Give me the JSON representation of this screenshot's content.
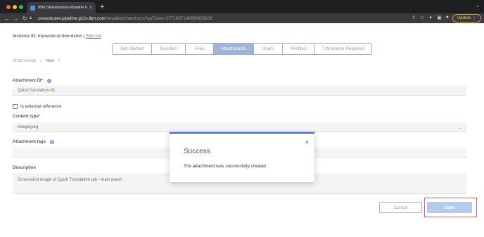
{
  "browser": {
    "tab_title": "IBM Globalization Pipeline New",
    "tab_close": "×",
    "new_tab": "+",
    "tab_menu": "⌄",
    "nav": {
      "back": "←",
      "forward": "→",
      "reload": "↻"
    },
    "url_host": "console.dev.pipeline.g11n.ibm.com",
    "url_path": "/newattachment.wss?gpToken=3771687149959903608",
    "update_label": "Update",
    "update_menu": "⋮",
    "icons": [
      "share-icon",
      "star-icon",
      "extension-icon",
      "sidebar-icon",
      "profile-icon"
    ]
  },
  "header": {
    "instance_label": "Instance ID: translate-at-ibm-demo |",
    "sign_out": "Sign out"
  },
  "tabs": [
    {
      "label": "Get Started",
      "active": false
    },
    {
      "label": "Bundles",
      "active": false
    },
    {
      "label": "Files",
      "active": false
    },
    {
      "label": "Attachments",
      "active": true
    },
    {
      "label": "Users",
      "active": false
    },
    {
      "label": "Profiles",
      "active": false
    },
    {
      "label": "Translation Requests",
      "active": false
    }
  ],
  "breadcrumb": {
    "root": "Attachments",
    "sep": "/",
    "current": "New",
    "trail": "/"
  },
  "form": {
    "attachment_id_label": "Attachment ID*",
    "attachment_id_value": "QuickTranslation-01",
    "external_ref_label": "Is external reference",
    "content_type_label": "Content type*",
    "content_type_value": "image/jpeg",
    "tags_label": "Attachment tags",
    "tags_value": "",
    "description_label": "Description",
    "description_value": "Screenshot image of Quick Translation tab - main panel"
  },
  "buttons": {
    "cancel": "Cancel",
    "save": "Save"
  },
  "modal": {
    "title": "Success",
    "message": "The attachment was successfully created.",
    "close": "×"
  },
  "colors": {
    "accent": "#3d70b2",
    "active_tab": "#91a9d4",
    "save": "#a7c1ec",
    "highlight": "#e0463b"
  }
}
